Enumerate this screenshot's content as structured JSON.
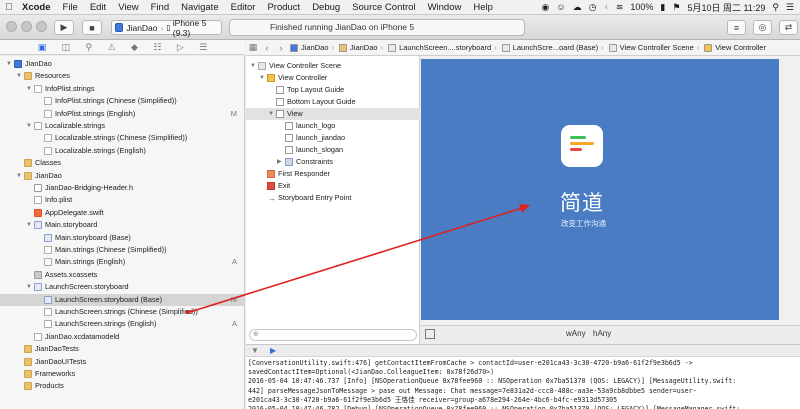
{
  "menubar": {
    "apple_icon": "apple-icon",
    "items": [
      "Xcode",
      "File",
      "Edit",
      "View",
      "Find",
      "Navigate",
      "Editor",
      "Product",
      "Debug",
      "Source Control",
      "Window",
      "Help"
    ],
    "battery": "100%",
    "date_time": "5月10日 周二  11:29"
  },
  "toolbar": {
    "scheme_target": "JianDao",
    "scheme_device": "iPhone 5 (9.3)",
    "status_text": "Finished running JianDao on iPhone 5"
  },
  "navigator": {
    "rows": [
      {
        "label": "JianDao",
        "badge": "",
        "type": "proj"
      },
      {
        "label": "Resources",
        "badge": "",
        "type": "folder"
      },
      {
        "label": "InfoPlist.strings",
        "badge": "",
        "type": "file"
      },
      {
        "label": "InfoPlist.strings (Chinese (Simplified))",
        "badge": "",
        "type": "file"
      },
      {
        "label": "InfoPlist.strings (English)",
        "badge": "M",
        "type": "file"
      },
      {
        "label": "Localizable.strings",
        "badge": "",
        "type": "file"
      },
      {
        "label": "Localizable.strings (Chinese (Simplified))",
        "badge": "",
        "type": "file"
      },
      {
        "label": "Localizable.strings (English)",
        "badge": "",
        "type": "file"
      },
      {
        "label": "Classes",
        "badge": "",
        "type": "folder"
      },
      {
        "label": "JianDao",
        "badge": "",
        "type": "folder"
      },
      {
        "label": "JianDao-Bridging-Header.h",
        "badge": "",
        "type": "hdr"
      },
      {
        "label": "Info.plist",
        "badge": "",
        "type": "file"
      },
      {
        "label": "AppDelegate.swift",
        "badge": "",
        "type": "swift"
      },
      {
        "label": "Main.storyboard",
        "badge": "",
        "type": "sb"
      },
      {
        "label": "Main.storyboard (Base)",
        "badge": "",
        "type": "sb"
      },
      {
        "label": "Main.strings (Chinese (Simplified))",
        "badge": "",
        "type": "file"
      },
      {
        "label": "Main.strings (English)",
        "badge": "A",
        "type": "file"
      },
      {
        "label": "Assets.xcassets",
        "badge": "",
        "type": "xc"
      },
      {
        "label": "LaunchScreen.storyboard",
        "badge": "",
        "type": "sb"
      },
      {
        "label": "LaunchScreen.storyboard (Base)",
        "badge": "M",
        "type": "sb"
      },
      {
        "label": "LaunchScreen.strings (Chinese (Simplified))",
        "badge": "",
        "type": "file"
      },
      {
        "label": "LaunchScreen.strings (English)",
        "badge": "A",
        "type": "file"
      },
      {
        "label": "JianDao.xcdatamodeld",
        "badge": "",
        "type": "file"
      },
      {
        "label": "JianDaoTests",
        "badge": "",
        "type": "folder"
      },
      {
        "label": "JianDaoUITests",
        "badge": "",
        "type": "folder"
      },
      {
        "label": "Frameworks",
        "badge": "",
        "type": "folder"
      },
      {
        "label": "Products",
        "badge": "",
        "type": "folder"
      }
    ]
  },
  "jumpbar": {
    "crumbs": [
      "JianDao",
      "JianDao",
      "LaunchScreen....storyboard",
      "LaunchScre...oard (Base)",
      "View Controller Scene",
      "View Controller"
    ]
  },
  "outline": {
    "rows": [
      {
        "label": "View Controller Scene"
      },
      {
        "label": "View Controller"
      },
      {
        "label": "Top Layout Guide"
      },
      {
        "label": "Bottom Layout Guide"
      },
      {
        "label": "View"
      },
      {
        "label": "launch_logo"
      },
      {
        "label": "launch_jiandao"
      },
      {
        "label": "launch_slogan"
      },
      {
        "label": "Constraints"
      },
      {
        "label": "First Responder"
      },
      {
        "label": "Exit"
      },
      {
        "label": "Storyboard Entry Point"
      }
    ],
    "filter_placeholder": ""
  },
  "canvas": {
    "app_title": "简道",
    "app_slogan": "改变工作沟通",
    "size_w": "Any",
    "size_h": "Any",
    "size_w_prefix": "w",
    "size_h_prefix": "h",
    "background_color": "#4a7cc4"
  },
  "console": {
    "lines": [
      "[ConversationUtility.swift:476] getContactItemFromCache > contactId=user-e201ca43-3c30-4720-b9a6-61f2f9e3b6d5 ->",
      "savedContactItem=Optional(<JianDao.ColleagueItem: 0x78f26d70>)",
      "2016-05-04 10:47:46.737 [Info] [NSOperationQueue 0x78fee960 :: NSOperation 0x7ba51370 (QOS: LEGACY)] [MessageUtility.swift:",
      "442] parseMessageJsonToMessage > pase out Message: Chat message=7e831a2d-ccc8-488c-aa3e-53a9cb8dbbe5 sender=user-",
      "e201ca43-3c30-4720-b9a6-61f2f9e3b6d5 王恪佳 receiver=group-a678e294-264e-4bc6-b4fc-e9313d57305",
      "2016-05-04 10:47:46.782 [Debug] [NSOperationQueue 0x78fee960 :: NSOperation 0x7ba51370 (QOS: LEGACY)] [MessageManager.swift:"
    ]
  },
  "colors": {
    "accent": "#2f6fe0",
    "annotation_arrow": "#e02020",
    "logo_green": "#3fbf5a",
    "logo_orange": "#f5a623",
    "logo_red": "#e8493f"
  }
}
